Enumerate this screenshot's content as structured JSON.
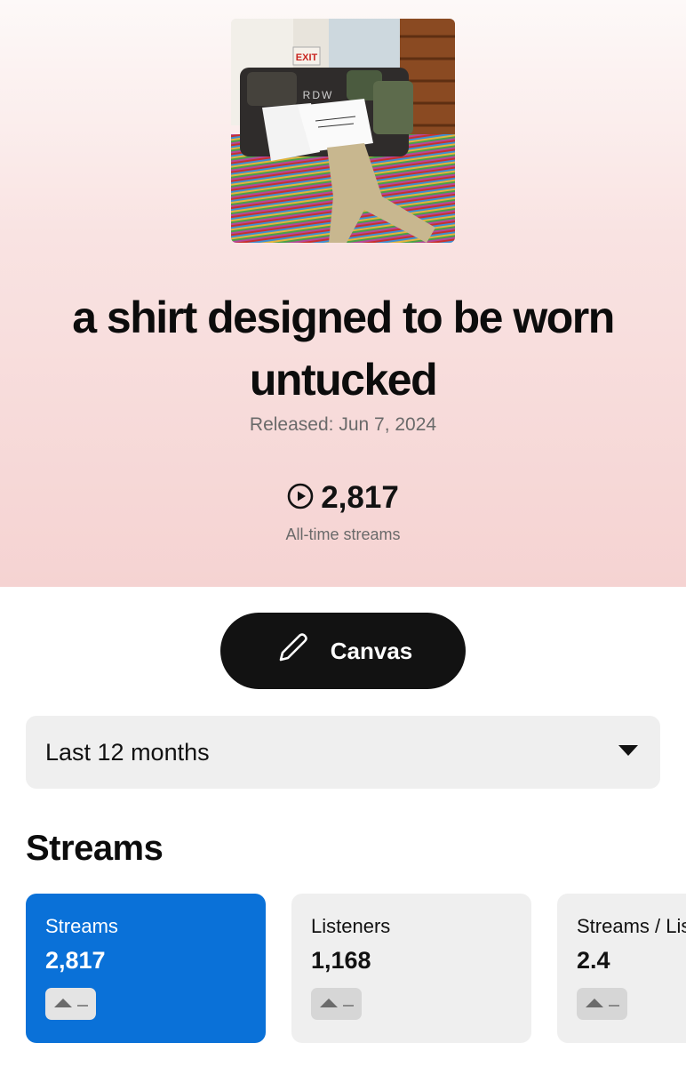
{
  "release": {
    "title": "a shirt designed to be worn untucked",
    "released": "Released: Jun 7, 2024",
    "total_streams": "2,817",
    "total_streams_label": "All-time streams"
  },
  "cover_art": {
    "lettering_sign": "EXIT",
    "lettering_couch": "RDW"
  },
  "canvas_button": {
    "label": "Canvas",
    "icon": "pencil-icon"
  },
  "date_range": {
    "selected": "Last 12 months",
    "icon": "caret-down-icon"
  },
  "streams_section": {
    "title": "Streams",
    "cards": [
      {
        "label": "Streams",
        "value": "2,817",
        "active": true
      },
      {
        "label": "Listeners",
        "value": "1,168",
        "active": false
      },
      {
        "label": "Streams / Listener",
        "value": "2.4",
        "active": false
      }
    ]
  },
  "colors": {
    "accent_blue": "#0a71d8",
    "button_dark": "#121212",
    "hero_pink": "#f5d3d2"
  }
}
